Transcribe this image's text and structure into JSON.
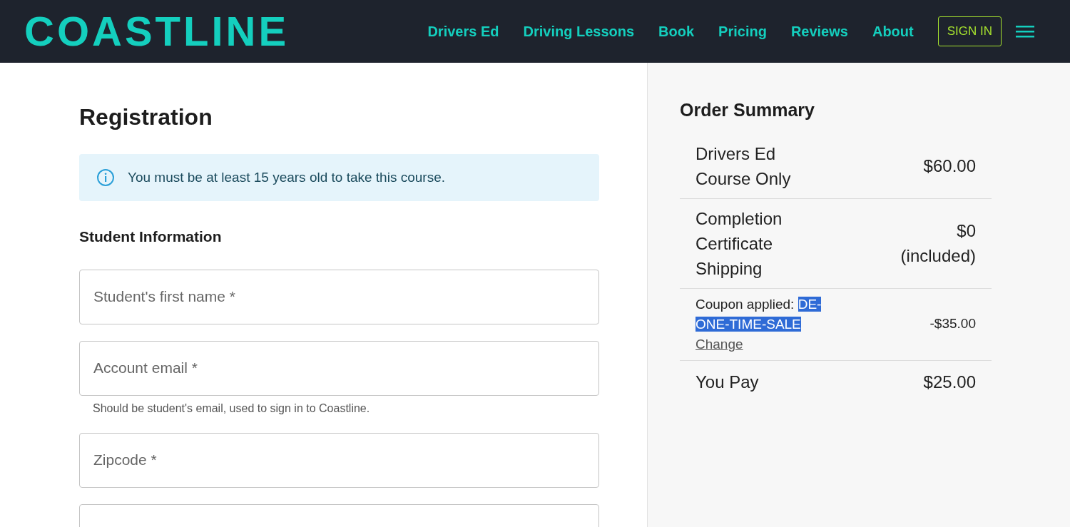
{
  "header": {
    "logo": "COASTLINE",
    "nav": [
      {
        "label": "Drivers Ed"
      },
      {
        "label": "Driving Lessons"
      },
      {
        "label": "Book"
      },
      {
        "label": "Pricing"
      },
      {
        "label": "Reviews"
      },
      {
        "label": "About"
      }
    ],
    "sign_in": "SIGN IN"
  },
  "registration": {
    "title": "Registration",
    "notice": "You must be at least 15 years old to take this course.",
    "section": "Student Information",
    "fields": [
      {
        "kind": "text",
        "placeholder": "Student's first name *"
      },
      {
        "kind": "text",
        "placeholder": "Account email *",
        "help": "Should be student's email, used to sign in to Coastline."
      },
      {
        "kind": "text",
        "placeholder": "Zipcode *"
      },
      {
        "kind": "text"
      }
    ]
  },
  "order_summary": {
    "title": "Order Summary",
    "rows": [
      {
        "kind": "item",
        "label": "Drivers Ed Course Only",
        "amount": "$60.00"
      },
      {
        "kind": "item",
        "label": "Completion Certificate Shipping",
        "amount": "$0 (included)"
      },
      {
        "kind": "coupon",
        "label": "Coupon applied:",
        "code": "DE-ONE-TIME-SALE",
        "code_highlighted": true,
        "link": "Change",
        "amount": "-$35.00"
      },
      {
        "kind": "total",
        "label": "You Pay",
        "amount": "$25.00"
      }
    ]
  }
}
